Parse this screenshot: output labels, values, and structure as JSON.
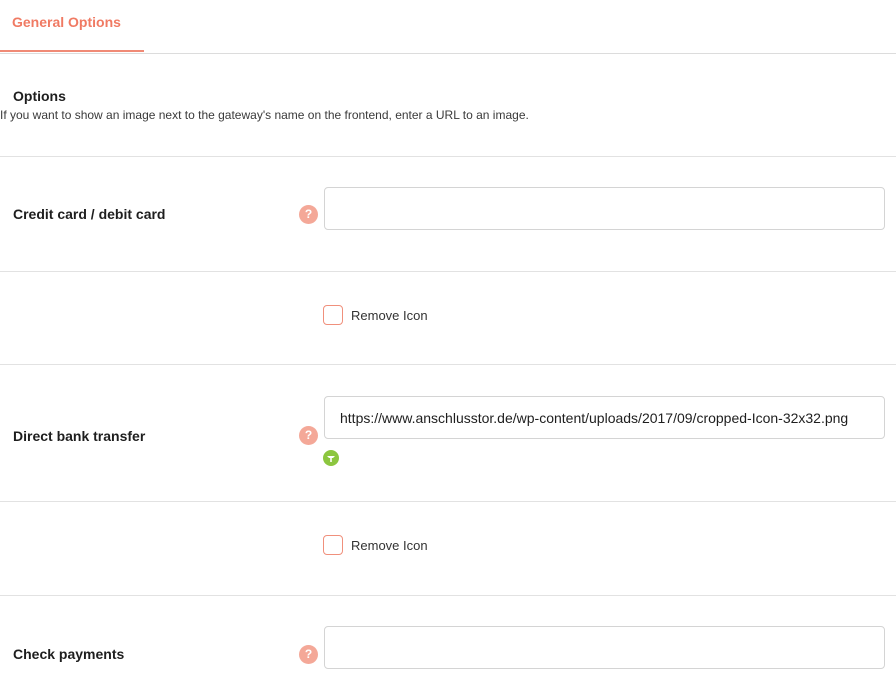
{
  "tabs": [
    {
      "label": "General Options"
    }
  ],
  "section": {
    "title": "Options",
    "description": "If you want to show an image next to the gateway's name on the frontend, enter a URL to an image."
  },
  "gateways": [
    {
      "label": "Credit card / debit card",
      "icon_url": "",
      "help_icon": "question-mark-icon"
    },
    {
      "label": "Direct bank transfer",
      "icon_url": "https://www.anschlusstor.de/wp-content/uploads/2017/09/cropped-Icon-32x32.png",
      "help_icon": "question-mark-icon",
      "preview_icon": "green-gateway-icon"
    },
    {
      "label": "Check payments",
      "icon_url": "",
      "help_icon": "question-mark-icon"
    }
  ],
  "remove_icon_label": "Remove Icon",
  "help_glyph": "?",
  "colors": {
    "accent": "#f07a63",
    "help_icon_bg": "#f4a898",
    "checkbox_border": "#f0907c",
    "preview_icon": "#8cc63f"
  }
}
